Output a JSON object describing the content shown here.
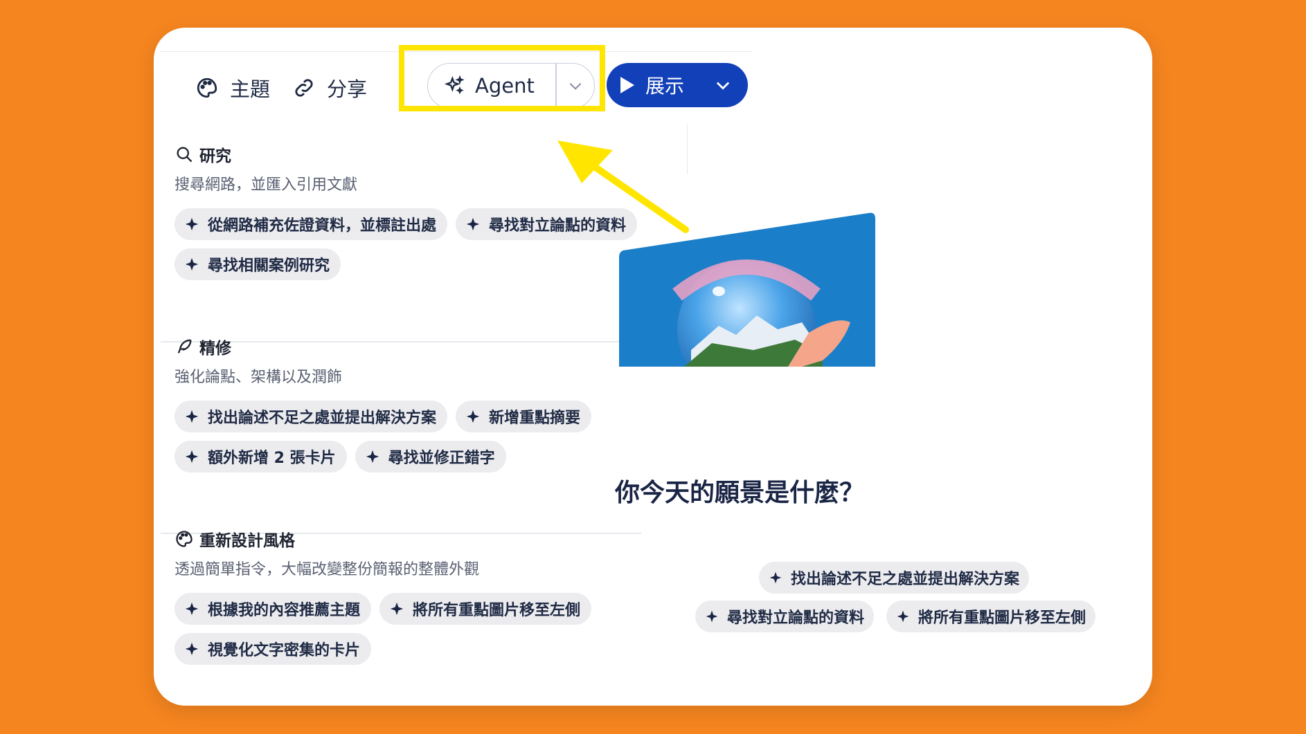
{
  "toolbar": {
    "theme_label": "主題",
    "share_label": "分享",
    "agent_label": "Agent",
    "present_label": "展示"
  },
  "sections": [
    {
      "title": "研究",
      "desc": "搜尋網路，並匯入引用文獻",
      "icon": "search-icon",
      "chips": [
        "從網路補充佐證資料，並標註出處",
        "尋找對立論點的資料",
        "尋找相關案例研究"
      ]
    },
    {
      "title": "精修",
      "desc": "強化論點、架構以及潤飾",
      "icon": "feather-icon",
      "chips": [
        "找出論述不足之處並提出解決方案",
        "新增重點摘要",
        "額外新增 2 張卡片",
        "尋找並修正錯字"
      ]
    },
    {
      "title": "重新設計風格",
      "desc": "透過簡單指令，大幅改變整份簡報的整體外觀",
      "icon": "palette-icon",
      "chips": [
        "根據我的內容推薦主題",
        "將所有重點圖片移至左側",
        "視覺化文字密集的卡片"
      ]
    }
  ],
  "right": {
    "title": "你今天的願景是什麼？",
    "chips": [
      "找出論述不足之處並提出解決方案",
      "尋找對立論點的資料",
      "將所有重點圖片移至左側"
    ]
  },
  "colors": {
    "background": "#F5851F",
    "present_button": "#1140B8",
    "highlight": "#FFE500",
    "chip_bg": "#ECECEF"
  }
}
